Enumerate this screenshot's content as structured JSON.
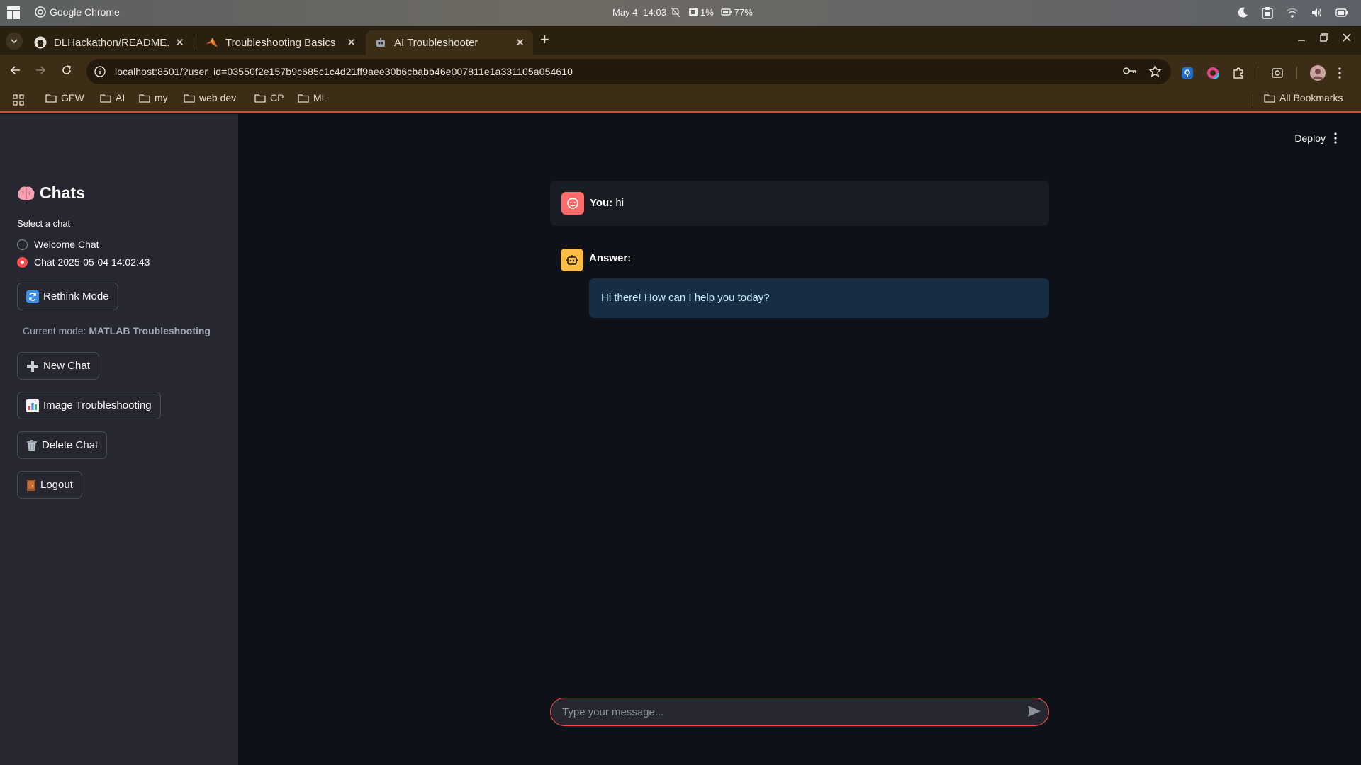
{
  "os": {
    "app_name": "Google Chrome",
    "date": "May 4",
    "time": "14:03",
    "cpu": "1%",
    "battery": "77%"
  },
  "tabs": [
    {
      "title": "DLHackathon/README.md",
      "active": false
    },
    {
      "title": "Troubleshooting Basics",
      "active": false
    },
    {
      "title": "AI Troubleshooter",
      "active": true
    }
  ],
  "address_bar": {
    "url": "localhost:8501/?user_id=03550f2e157b9c685c1c4d21ff9aee30b6cbabb46e007811e1a331105a054610"
  },
  "bookmarks": {
    "items": [
      "GFW",
      "AI",
      "my",
      "web dev",
      "CP",
      "ML"
    ],
    "all_label": "All Bookmarks"
  },
  "sidebar": {
    "title": "Chats",
    "select_label": "Select a chat",
    "chats": [
      {
        "label": "Welcome Chat",
        "selected": false
      },
      {
        "label": "Chat 2025-05-04 14:02:43",
        "selected": true
      }
    ],
    "rethink_button": "Rethink Mode",
    "mode_prefix": "Current mode:",
    "mode_value": "MATLAB Troubleshooting",
    "new_chat_button": "New Chat",
    "image_button": "Image Troubleshooting",
    "delete_button": "Delete Chat",
    "logout_button": "Logout"
  },
  "header": {
    "deploy_label": "Deploy"
  },
  "chat": {
    "user_prefix": "You:",
    "user_message": "hi",
    "answer_label": "Answer:",
    "answer_text": "Hi there! How can I help you today?",
    "input_placeholder": "Type your message..."
  },
  "colors": {
    "accent": "#ff4b4b",
    "sidebar_bg": "#262730",
    "main_bg": "#0e1117",
    "answer_bg": "#172d43"
  }
}
